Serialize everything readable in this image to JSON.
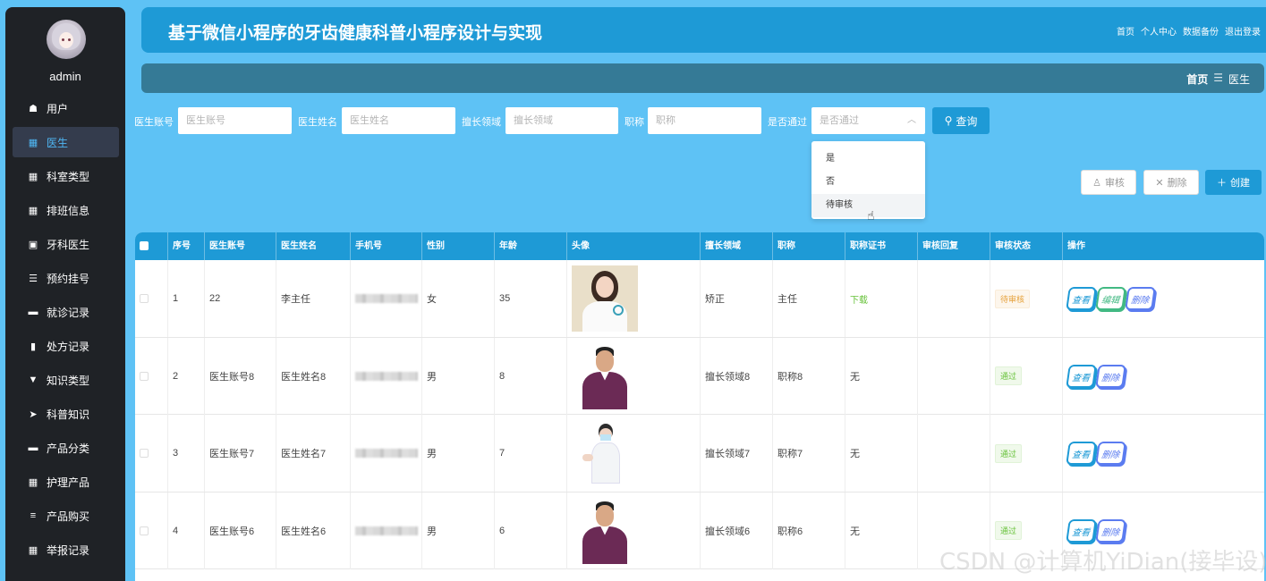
{
  "sidebar": {
    "username": "admin",
    "items": [
      {
        "label": "用户",
        "icon": "user-icon",
        "glyph": "☗"
      },
      {
        "label": "医生",
        "icon": "grid-icon",
        "glyph": "▦",
        "active": true
      },
      {
        "label": "科室类型",
        "icon": "grid-icon",
        "glyph": "▦"
      },
      {
        "label": "排班信息",
        "icon": "grid-icon",
        "glyph": "▦"
      },
      {
        "label": "牙科医生",
        "icon": "briefcase-icon",
        "glyph": "▣"
      },
      {
        "label": "预约挂号",
        "icon": "sliders-icon",
        "glyph": "☰"
      },
      {
        "label": "就诊记录",
        "icon": "monitor-icon",
        "glyph": "▬"
      },
      {
        "label": "处方记录",
        "icon": "book-icon",
        "glyph": "▮"
      },
      {
        "label": "知识类型",
        "icon": "pin-icon",
        "glyph": "▼"
      },
      {
        "label": "科普知识",
        "icon": "send-icon",
        "glyph": "➤"
      },
      {
        "label": "产品分类",
        "icon": "monitor-icon",
        "glyph": "▬"
      },
      {
        "label": "护理产品",
        "icon": "grid-icon",
        "glyph": "▦"
      },
      {
        "label": "产品购买",
        "icon": "list-icon",
        "glyph": "≡"
      },
      {
        "label": "举报记录",
        "icon": "grid-icon",
        "glyph": "▦"
      }
    ]
  },
  "header": {
    "title": "基于微信小程序的牙齿健康科普小程序设计与实现",
    "links": [
      "首页",
      "个人中心",
      "数据备份",
      "退出登录"
    ]
  },
  "breadcrumb": {
    "home": "首页",
    "sep": "☰",
    "current": "医生"
  },
  "search": {
    "fields": [
      {
        "label": "医生账号",
        "placeholder": "医生账号"
      },
      {
        "label": "医生姓名",
        "placeholder": "医生姓名"
      },
      {
        "label": "擅长领域",
        "placeholder": "擅长领域"
      },
      {
        "label": "职称",
        "placeholder": "职称"
      }
    ],
    "select": {
      "label": "是否通过",
      "placeholder": "是否通过",
      "options": [
        "是",
        "否",
        "待审核"
      ]
    },
    "button": "查询"
  },
  "actions": {
    "audit": "审核",
    "delete": "删除",
    "create": "创建"
  },
  "table": {
    "headers": [
      "序号",
      "医生账号",
      "医生姓名",
      "手机号",
      "性别",
      "年龄",
      "头像",
      "擅长领域",
      "职称",
      "职称证书",
      "审核回复",
      "审核状态",
      "操作"
    ],
    "rows": [
      {
        "index": "1",
        "account": "22",
        "name": "李主任",
        "gender": "女",
        "age": "35",
        "photo": "woman",
        "field": "矫正",
        "title": "主任",
        "cert": "下载",
        "reply": "",
        "status": "待审核",
        "status_type": "pending",
        "ops": [
          "查看",
          "编辑",
          "删除"
        ]
      },
      {
        "index": "2",
        "account": "医生账号8",
        "name": "医生姓名8",
        "gender": "男",
        "age": "8",
        "photo": "man",
        "field": "擅长领域8",
        "title": "职称8",
        "cert": "无",
        "reply": "",
        "status": "通过",
        "status_type": "pass",
        "ops": [
          "查看",
          "删除"
        ]
      },
      {
        "index": "3",
        "account": "医生账号7",
        "name": "医生姓名7",
        "gender": "男",
        "age": "7",
        "photo": "nurse",
        "field": "擅长领域7",
        "title": "职称7",
        "cert": "无",
        "reply": "",
        "status": "通过",
        "status_type": "pass",
        "ops": [
          "查看",
          "删除"
        ]
      },
      {
        "index": "4",
        "account": "医生账号6",
        "name": "医生姓名6",
        "gender": "男",
        "age": "6",
        "photo": "man",
        "field": "擅长领域6",
        "title": "职称6",
        "cert": "无",
        "reply": "",
        "status": "通过",
        "status_type": "pass",
        "ops": [
          "查看",
          "删除"
        ]
      }
    ]
  },
  "watermark": "CSDN @计算机YiDian(接毕设)",
  "colors": {
    "primary": "#1e9ad6",
    "sidebar": "#1f2226",
    "background": "#5ec2f5"
  }
}
